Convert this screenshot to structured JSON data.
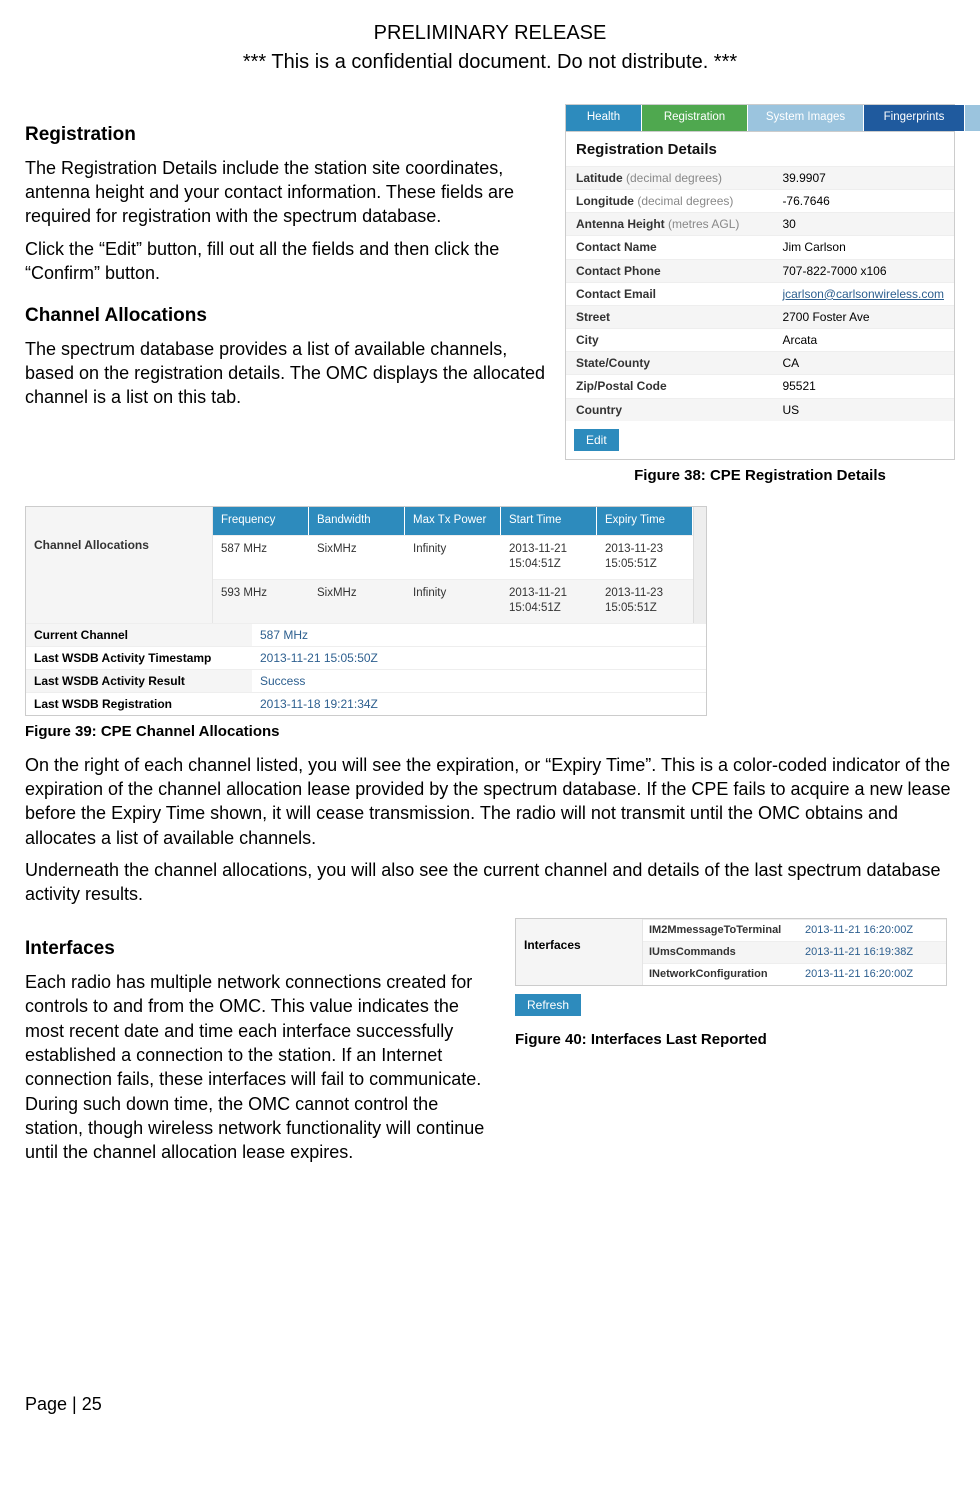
{
  "header": {
    "preliminary": "PRELIMINARY RELEASE",
    "confidential": "*** This is a confidential document. Do not distribute. ***"
  },
  "sections": {
    "registration_title": "Registration",
    "registration_p1": "The Registration Details include the station site coordinates, antenna height and your contact information. These fields are required for registration with the spectrum database.",
    "registration_p2": "Click the “Edit” button, fill out all the fields and then click the “Confirm” button.",
    "channel_title": "Channel Allocations",
    "channel_p1": "The spectrum database provides a list of available channels, based on the registration details. The OMC displays the allocated channel is a list on this tab.",
    "channel_p2": "On the right of each channel listed, you will see the expiration, or “Expiry Time”. This is a color-coded indicator of the expiration of the channel allocation lease provided by the spectrum database. If the CPE fails to acquire a new lease before the Expiry Time shown, it will cease transmission. The radio will not transmit until the OMC obtains and allocates a list of available channels.",
    "channel_p3": "Underneath the channel allocations, you will also see the current channel and details of the last spectrum database activity results.",
    "interfaces_title": "Interfaces",
    "interfaces_p1": "Each radio has multiple network connections created for controls to and from the OMC. This value indicates the most recent date and time each interface successfully established a connection to the station. If an Internet connection fails, these interfaces will fail to communicate. During such down time, the OMC cannot control the station, though wireless network functionality will continue until the channel allocation lease expires."
  },
  "fig38": {
    "caption": "Figure 38: CPE Registration Details",
    "tabs": {
      "health": "Health",
      "registration": "Registration",
      "system_images": "System Images",
      "fingerprints": "Fingerprints"
    },
    "panel_title": "Registration Details",
    "rows": {
      "lat_label": "Latitude",
      "lat_hint": "(decimal degrees)",
      "lat_val": "39.9907",
      "lon_label": "Longitude",
      "lon_hint": "(decimal degrees)",
      "lon_val": "-76.7646",
      "ant_label": "Antenna Height",
      "ant_hint": "(metres AGL)",
      "ant_val": "30",
      "name_label": "Contact Name",
      "name_val": "Jim Carlson",
      "phone_label": "Contact Phone",
      "phone_val": "707-822-7000 x106",
      "email_label": "Contact Email",
      "email_val": "jcarlson@carlsonwireless.com",
      "street_label": "Street",
      "street_val": "2700 Foster Ave",
      "city_label": "City",
      "city_val": "Arcata",
      "state_label": "State/County",
      "state_val": "CA",
      "zip_label": "Zip/Postal Code",
      "zip_val": "95521",
      "country_label": "Country",
      "country_val": "US"
    },
    "edit_btn": "Edit"
  },
  "fig39": {
    "caption": "Figure 39: CPE Channel Allocations",
    "side_label": "Channel Allocations",
    "cols": {
      "freq": "Frequency",
      "bw": "Bandwidth",
      "pwr": "Max Tx Power",
      "start": "Start Time",
      "expiry": "Expiry Time"
    },
    "rows": [
      {
        "freq": "587 MHz",
        "bw": "SixMHz",
        "pwr": "Infinity",
        "start": "2013-11-21 15:04:51Z",
        "expiry": "2013-11-23 15:05:51Z"
      },
      {
        "freq": "593 MHz",
        "bw": "SixMHz",
        "pwr": "Infinity",
        "start": "2013-11-21 15:04:51Z",
        "expiry": "2013-11-23 15:05:51Z"
      }
    ],
    "status": {
      "cur_lbl": "Current Channel",
      "cur_val": "587 MHz",
      "act_ts_lbl": "Last WSDB Activity Timestamp",
      "act_ts_val": "2013-11-21 15:05:50Z",
      "act_res_lbl": "Last WSDB Activity Result",
      "act_res_val": "Success",
      "reg_lbl": "Last WSDB Registration",
      "reg_val": "2013-11-18 19:21:34Z"
    }
  },
  "fig40": {
    "caption": "Figure 40: Interfaces Last Reported",
    "side_label": "Interfaces",
    "rows": [
      {
        "name": "IM2MmessageToTerminal",
        "time": "2013-11-21 16:20:00Z"
      },
      {
        "name": "IUmsCommands",
        "time": "2013-11-21 16:19:38Z"
      },
      {
        "name": "INetworkConfiguration",
        "time": "2013-11-21 16:20:00Z"
      }
    ],
    "refresh_btn": "Refresh"
  },
  "footer": {
    "page": "Page | 25"
  }
}
